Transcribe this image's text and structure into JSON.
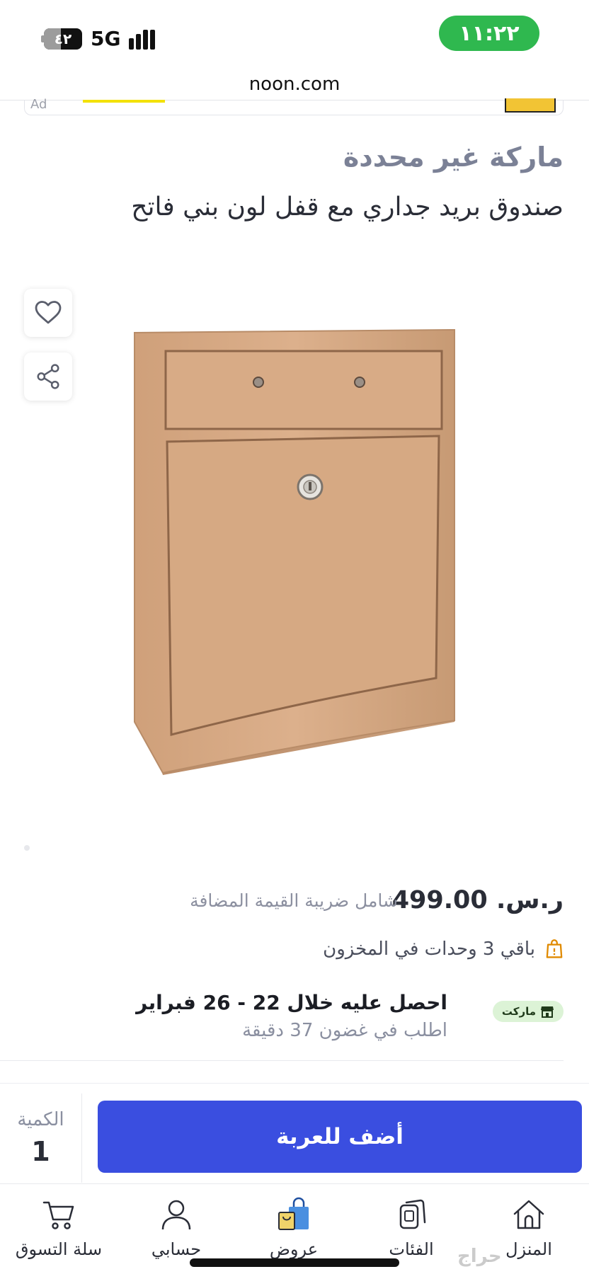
{
  "status_bar": {
    "time": "١١:٢٢",
    "battery": "٤٢",
    "network": "5G"
  },
  "browser": {
    "url": "noon.com"
  },
  "ad": {
    "label": "Ad"
  },
  "product": {
    "brand": "ماركة غير محددة",
    "title": "صندوق بريد جداري مع قفل لون بني فاتح",
    "image_icon": "mailbox-product-image",
    "favorite_icon": "heart-icon",
    "share_icon": "share-icon"
  },
  "pricing": {
    "price": "ر.س. 499.00",
    "vat_note": "شامل ضريبة القيمة المضافة"
  },
  "stock": {
    "text": "باقي 3 وحدات في المخزون",
    "icon": "shopping-bag-icon"
  },
  "delivery": {
    "main": "احصل عليه خلال 22 - 26 فبراير",
    "sub": "اطلب في غضون 37 دقيقة",
    "badge": "ماركت",
    "badge_icon": "store-icon"
  },
  "cart_bar": {
    "qty_label": "الكمية",
    "qty_value": "1",
    "add_button": "أضف للعربة"
  },
  "bottom_nav": {
    "items": [
      {
        "label": "سلة التسوق",
        "icon": "cart-icon"
      },
      {
        "label": "حسابي",
        "icon": "user-icon"
      },
      {
        "label": "عروض",
        "icon": "shopping-bag-icon"
      },
      {
        "label": "الفئات",
        "icon": "categories-icon"
      },
      {
        "label": "المنزل",
        "icon": "home-icon"
      }
    ]
  },
  "watermark": "حراج",
  "colors": {
    "accent": "#3a4ee0",
    "time_pill": "#2fb84f",
    "brand_text": "#7b8196",
    "market_badge": "#dcf3d6",
    "stock_icon": "#e08a00"
  }
}
